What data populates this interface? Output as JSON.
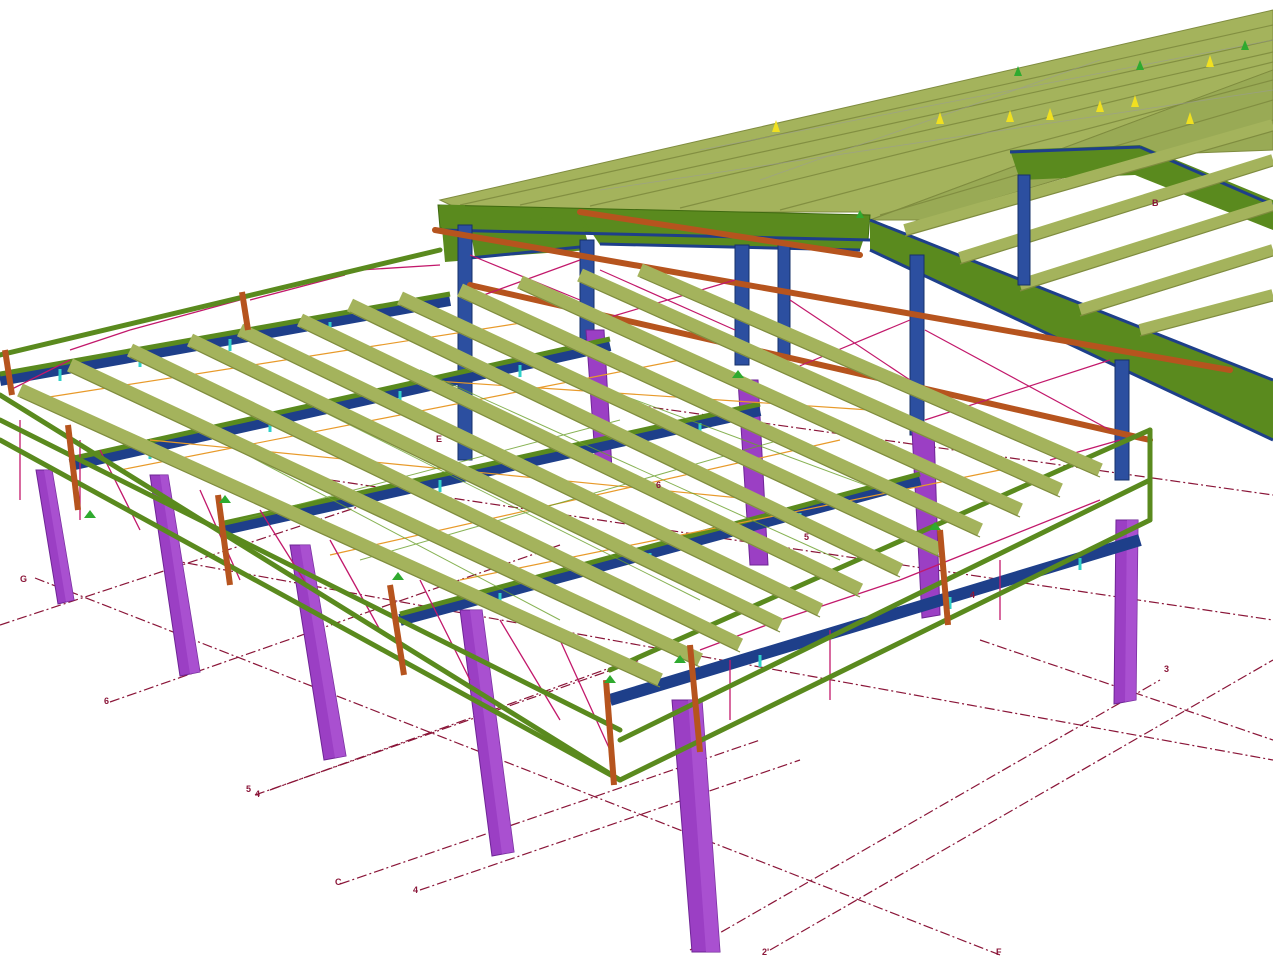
{
  "colors": {
    "background": "#ffffff",
    "roof_purlin": "#a4b35c",
    "roof_purlin_dark": "#7f8c3f",
    "beam_green": "#5a8a1e",
    "beam_blue": "#1e3f8a",
    "column_purple": "#9b3fc4",
    "column_purple_dark": "#6f2596",
    "column_blue": "#2c4fa0",
    "brace_magenta": "#c2186b",
    "tie_orange": "#b6541e",
    "gridline": "#8a1538",
    "stiffener_cyan": "#2fd0c8",
    "marker_yellow": "#f0e020",
    "marker_green": "#2faa2f"
  },
  "grid_labels": [
    {
      "id": "G",
      "text": "G"
    },
    {
      "id": "6a",
      "text": "6"
    },
    {
      "id": "5",
      "text": "5"
    },
    {
      "id": "4",
      "text": "4"
    },
    {
      "id": "C",
      "text": "C"
    },
    {
      "id": "4b",
      "text": "4"
    },
    {
      "id": "2",
      "text": "2'"
    },
    {
      "id": "F",
      "text": "F"
    },
    {
      "id": "3",
      "text": "3"
    },
    {
      "id": "E",
      "text": "E"
    },
    {
      "id": "B",
      "text": "B"
    },
    {
      "id": "4c",
      "text": "4"
    },
    {
      "id": "5b",
      "text": "5"
    },
    {
      "id": "6b",
      "text": "6"
    }
  ],
  "icons": {
    "support_marker": "triangle-marker-icon",
    "load_marker": "cone-marker-icon"
  }
}
